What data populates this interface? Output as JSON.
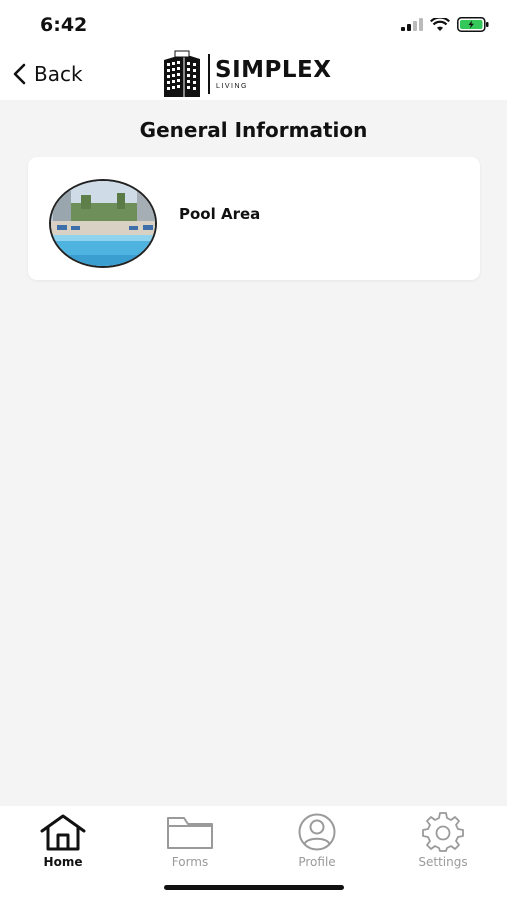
{
  "status_bar": {
    "time": "6:42",
    "battery_color": "#34c759"
  },
  "header": {
    "back_label": "Back",
    "logo_name": "SIMPLEX",
    "logo_sub": "LIVING"
  },
  "page": {
    "title": "General Information",
    "items": [
      {
        "label": "Pool Area",
        "image": "pool-photo"
      }
    ]
  },
  "tab_bar": {
    "tabs": [
      {
        "label": "Home",
        "icon": "home-icon",
        "active": true
      },
      {
        "label": "Forms",
        "icon": "folder-icon",
        "active": false
      },
      {
        "label": "Profile",
        "icon": "profile-icon",
        "active": false
      },
      {
        "label": "Settings",
        "icon": "gear-icon",
        "active": false
      }
    ]
  },
  "colors": {
    "background": "#f4f4f4",
    "card": "#ffffff",
    "text": "#111111",
    "inactive": "#9a9a9a"
  }
}
